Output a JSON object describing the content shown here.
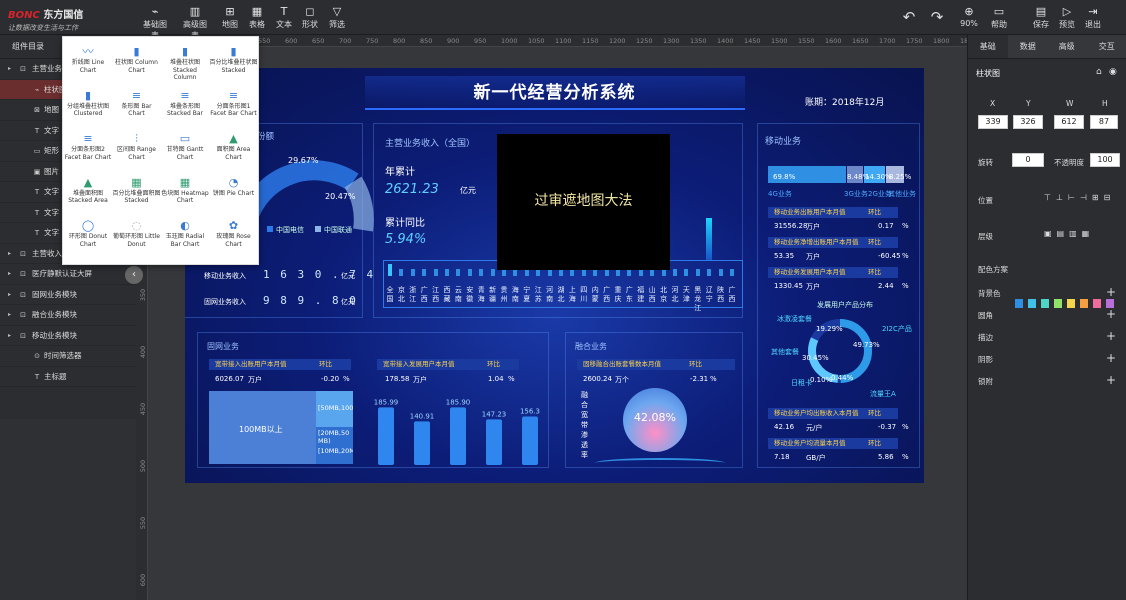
{
  "brand": {
    "name_prefix": "BONC",
    "name": "东方国信",
    "slogan": "让数据改变生活与工作"
  },
  "toolbar": {
    "left": [
      {
        "icon": "line-chart-icon",
        "label": "基础图表"
      },
      {
        "icon": "bar-chart-icon",
        "label": "高级图表"
      },
      {
        "icon": "map-icon",
        "label": "地图"
      },
      {
        "icon": "table-icon",
        "label": "表格"
      },
      {
        "icon": "text-icon",
        "label": "文本"
      },
      {
        "icon": "shape-icon",
        "label": "形状"
      },
      {
        "icon": "filter-icon",
        "label": "筛选"
      }
    ],
    "undo": "↶",
    "redo": "↷",
    "zoom": "90%",
    "help": "帮助",
    "save": "保存",
    "preview": "预览",
    "exit": "退出"
  },
  "left": {
    "title": "组件目录",
    "rows": [
      "主营业务收入",
      "柱状图",
      "地图",
      "文字",
      "矩形",
      "图片",
      "文字",
      "文字",
      "文字",
      "主营收入…",
      "医疗静默认证大屏",
      "固网业务模块",
      "融合业务模块",
      "移动业务模块",
      "时间筛选器",
      "主标题"
    ]
  },
  "picker": [
    [
      "折线图 Line Chart",
      "柱状图 Column Chart",
      "堆叠柱状图 Stacked Column",
      "百分比堆叠柱状图 Stacked"
    ],
    [
      "分组堆叠柱状图 Clustered",
      "条形图 Bar Chart",
      "堆叠条形图 Stacked Bar",
      "分面条形图1 Facet Bar Chart"
    ],
    [
      "分面条形图2 Facet Bar Chart",
      "区间图 Range Chart",
      "甘特图 Gantt Chart",
      "面积图 Area Chart"
    ],
    [
      "堆叠面积图 Stacked Area",
      "百分比堆叠面积图 Stacked",
      "色块图 Heatmap Chart",
      "饼图 Pie Chart"
    ],
    [
      "环形图 Donut Chart",
      "葡萄环形图 Little Donut",
      "玉珏图 Radial Bar Chart",
      "玫瑰图 Rose Chart"
    ]
  ],
  "ruler": {
    "top": [
      "350",
      "400",
      "450",
      "500",
      "550",
      "600",
      "650",
      "700",
      "750",
      "800",
      "850",
      "900",
      "950",
      "1000",
      "1050",
      "1100",
      "1150",
      "1200",
      "1250",
      "1300",
      "1350",
      "1400",
      "1450",
      "1500",
      "1550",
      "1600",
      "1650",
      "1700",
      "1750",
      "1800",
      "1850"
    ],
    "left": [
      "150",
      "200",
      "250",
      "300",
      "350",
      "400",
      "450",
      "500",
      "550",
      "600"
    ]
  },
  "dashboard": {
    "title": "新一代经营分析系统",
    "period": "账期：2018年12月",
    "top_left": {
      "title": "份额",
      "pct1": "29.67%",
      "pct2": "20.47%",
      "legend": [
        "中国电信",
        "中国联通"
      ],
      "rows": [
        {
          "label": "移动业务收入",
          "digits": "1 6 3 0 . 7 4",
          "unit": "亿元"
        },
        {
          "label": "固网业务收入",
          "digits": "9 8 9 . 8 0",
          "unit": "亿元"
        }
      ]
    },
    "main": {
      "title": "主营业务收入（全国）",
      "year_label": "年累计",
      "year_value": "2621.23",
      "year_unit": "亿元",
      "yoy_label": "累计同比",
      "yoy_value": "5.94%",
      "provinces": [
        "全国",
        "京北",
        "浙江",
        "广西",
        "江西",
        "西藏",
        "云南",
        "安徽",
        "青海",
        "新疆",
        "贵州",
        "海南",
        "宁夏",
        "江苏",
        "河南",
        "湖北",
        "上海",
        "四川",
        "内蒙",
        "广西",
        "重庆",
        "广东",
        "福建",
        "山西",
        "北京",
        "河北",
        "天津",
        "黑龙江",
        "辽宁",
        "陕西",
        "广西"
      ]
    },
    "mask": "过审遮地图大法",
    "mobile": {
      "title": "移动业务",
      "bar_labels": [
        "69.8%",
        "8.48%",
        "14.30%",
        "8.25%"
      ],
      "legend": [
        "4G业务",
        "3G业务",
        "2G业务",
        "其他业务"
      ],
      "rows": [
        {
          "h": "移动业务出账用户本月值",
          "h2": "环比",
          "v": "31556.28",
          "u": "万户",
          "c": "0.17",
          "cu": "%"
        },
        {
          "h": "移动业务净增出账用户本月值",
          "h2": "环比",
          "v": "53.35",
          "u": "万户",
          "c": "-60.45",
          "cu": "%"
        },
        {
          "h": "移动业务发展用户本月值",
          "h2": "环比",
          "v": "1330.45",
          "u": "万户",
          "c": "2.44",
          "cu": "%"
        }
      ],
      "dist_title": "发展用户产品分布",
      "dist": [
        "冰激凌套餐",
        "19.29%",
        "2I2C产品",
        "49.73%",
        "其他套餐",
        "30.45%",
        "日租卡",
        "0.10%",
        "0.44%",
        "流量王A"
      ],
      "rows2": [
        {
          "h": "移动业务户均出账收入本月值",
          "h2": "环比",
          "v": "42.16",
          "u": "元/户",
          "c": "-0.37",
          "cu": "%"
        },
        {
          "h": "移动业务户均流量本月值",
          "h2": "环比",
          "v": "7.18",
          "u": "GB/户",
          "c": "5.86",
          "cu": "%"
        }
      ]
    },
    "fixed": {
      "title": "固网业务",
      "h1": "宽带接入出账用户本月值",
      "h1b": "环比",
      "v1": "6026.07",
      "u1": "万户",
      "c1": "-0.20",
      "cu1": "%",
      "h2": "宽带接入发展用户本月值",
      "h2b": "环比",
      "v2": "178.58",
      "u2": "万户",
      "c2": "1.04",
      "cu2": "%",
      "tree": [
        "100MB以上",
        "[50MB,100",
        "[20MB,50 MB)",
        "[10MB,20M"
      ],
      "bars": [
        {
          "label": "185.99",
          "value": 185.99
        },
        {
          "label": "140.91",
          "value": 140.91
        },
        {
          "label": "185.90",
          "value": 185.9
        },
        {
          "label": "147.23",
          "value": 147.23
        },
        {
          "label": "156.3",
          "value": 156.3
        }
      ]
    },
    "fusion": {
      "title": "融合业务",
      "h": "固移融合出账套餐数本月值",
      "h2": "环比",
      "v": "2600.24",
      "u": "万个",
      "c": "-2.31",
      "cu": "%",
      "side": "融合宽带渗透率",
      "pct": "42.08%"
    }
  },
  "right": {
    "tabs": [
      "基础",
      "数据",
      "高级",
      "交互"
    ],
    "component": "柱状图",
    "xl": "X",
    "yl": "Y",
    "wl": "W",
    "hl": "H",
    "x": "339",
    "y": "326",
    "w": "612",
    "h": "87",
    "rotate_label": "旋转",
    "rotate": "0",
    "opacity_label": "不透明度",
    "opacity": "100",
    "position_label": "位置",
    "layer_label": "层级",
    "palette_label": "配色方案",
    "palette": [
      "#2e8fe3",
      "#3fc1e8",
      "#4ed7c6",
      "#8fe36a",
      "#f4d54c",
      "#f5a142",
      "#f06c9b",
      "#b86fd9"
    ],
    "sections": [
      "背景色",
      "圆角",
      "描边",
      "阴影",
      "锁附"
    ]
  }
}
